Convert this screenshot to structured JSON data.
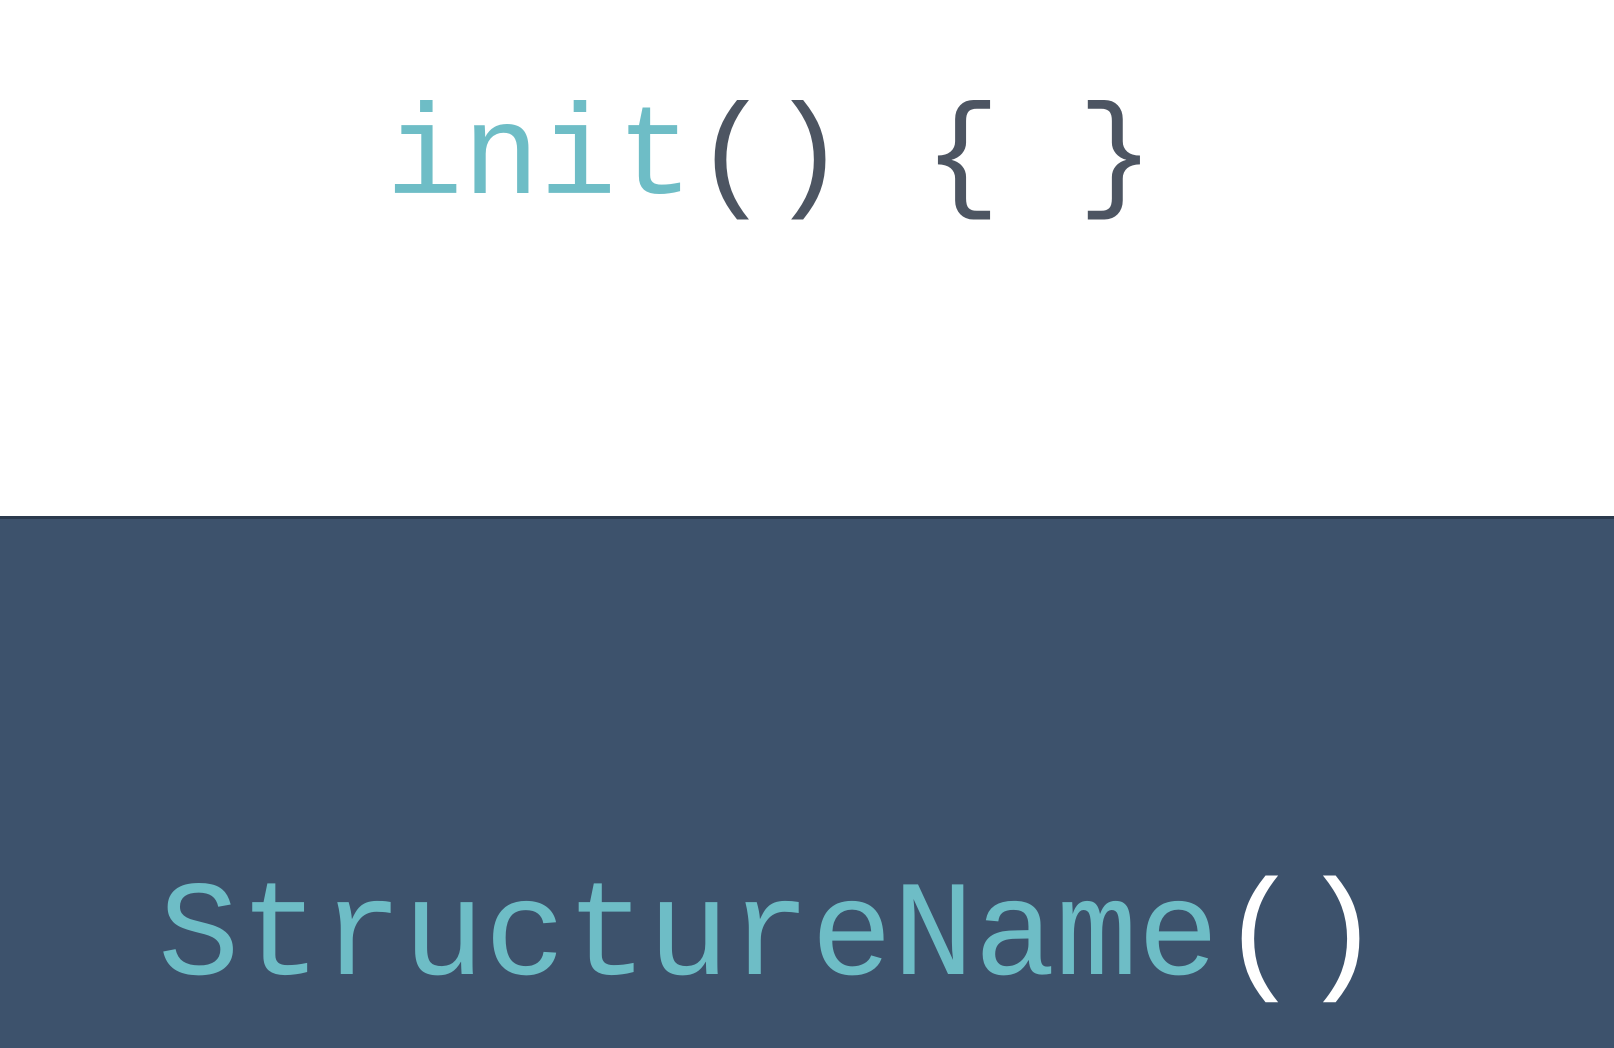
{
  "top_code": {
    "keyword": "init",
    "params": "()",
    "body": " { }"
  },
  "bottom_code": {
    "type_name": "StructureName",
    "call": "()"
  },
  "colors": {
    "top_background": "#ffffff",
    "bottom_background": "#3d526c",
    "keyword": "#6ebdc6",
    "punctuation_dark": "#4d5562",
    "punctuation_light": "#ffffff"
  }
}
